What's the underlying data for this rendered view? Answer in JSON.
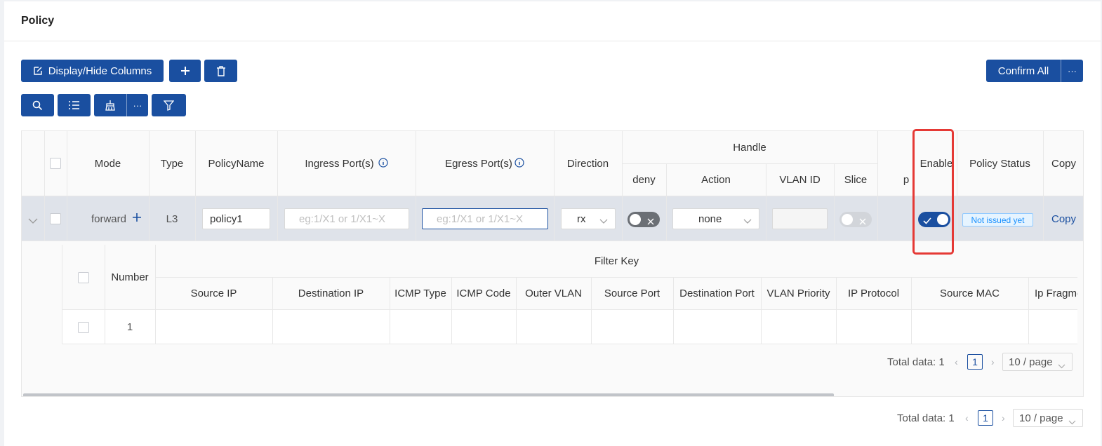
{
  "page": {
    "title": "Policy"
  },
  "toolbar": {
    "display_hide_columns": "Display/Hide Columns",
    "add_icon": "plus-icon",
    "delete_icon": "trash-icon",
    "confirm_all": "Confirm All",
    "more": "···"
  },
  "toolbar2": {
    "search_icon": "search-icon",
    "list_icon": "list-icon",
    "clean_icon": "broom-icon",
    "more": "···",
    "filter_icon": "filter-icon"
  },
  "table": {
    "headers": {
      "mode": "Mode",
      "type": "Type",
      "policy_name": "PolicyName",
      "ingress": "Ingress Port(s)",
      "egress": "Egress Port(s)",
      "direction": "Direction",
      "handle": "Handle",
      "deny": "deny",
      "action": "Action",
      "vlan_id": "VLAN ID",
      "slice": "Slice",
      "partial": "p",
      "enable": "Enable",
      "policy_status": "Policy Status",
      "copy": "Copy"
    },
    "row": {
      "mode": "forward",
      "type": "L3",
      "policy_name": "policy1",
      "ingress_placeholder": "eg:1/X1 or 1/X1~X",
      "egress_placeholder": "eg:1/X1 or 1/X1~X",
      "direction": "rx",
      "action": "none",
      "deny_enabled": false,
      "slice_enabled": false,
      "enable": true,
      "status": "Not issued yet",
      "copy": "Copy"
    }
  },
  "subtable": {
    "headers": {
      "number": "Number",
      "filter_key": "Filter Key",
      "source_ip": "Source IP",
      "destination_ip": "Destination IP",
      "icmp_type": "ICMP Type",
      "icmp_code": "ICMP Code",
      "outer_vlan": "Outer VLAN",
      "source_port": "Source Port",
      "destination_port": "Destination Port",
      "vlan_priority": "VLAN Priority",
      "ip_protocol": "IP Protocol",
      "source_mac": "Source MAC",
      "ip_fragment": "Ip Fragme"
    },
    "rows": [
      {
        "number": "1"
      }
    ]
  },
  "sub_pagination": {
    "total": "Total data: 1",
    "page": "1",
    "per_page": "10 / page"
  },
  "pagination": {
    "total": "Total data: 1",
    "page": "1",
    "per_page": "10 / page"
  },
  "colors": {
    "primary": "#1a4fa0",
    "highlight": "#e53935",
    "row_selected": "#dfe3ea",
    "status_blue": "#1890ff"
  }
}
